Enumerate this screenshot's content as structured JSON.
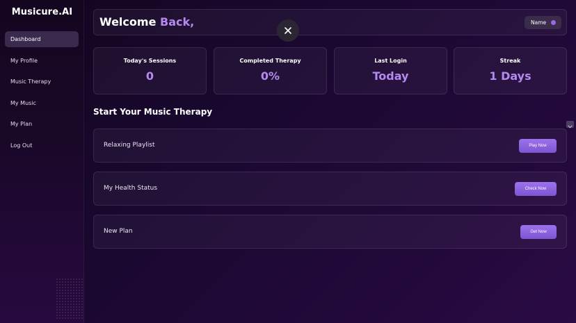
{
  "brand": "Musicure.AI",
  "sidebar": {
    "items": [
      {
        "label": "Dashboard"
      },
      {
        "label": "My Profile"
      },
      {
        "label": "Music Therapy"
      },
      {
        "label": "My Music"
      },
      {
        "label": "My Plan"
      },
      {
        "label": "Log Out"
      }
    ]
  },
  "header": {
    "welcome": "Welcome",
    "welcome_accent": "Back,",
    "name_toggle_label": "Name"
  },
  "stats": [
    {
      "title": "Today's Sessions",
      "value": "0"
    },
    {
      "title": "Completed Therapy",
      "value": "0%"
    },
    {
      "title": "Last Login",
      "value": "Today"
    },
    {
      "title": "Streak",
      "value": "1 Days"
    }
  ],
  "section": {
    "title": "Start Your Music Therapy"
  },
  "rows": [
    {
      "label": "Relaxing Playlist",
      "button": "Play Now"
    },
    {
      "label": "My Health Status",
      "button": "Check Now"
    },
    {
      "label": "New Plan",
      "button": "Get Now"
    }
  ],
  "icons": {
    "close": "close-icon",
    "chevron": "chevron-down-icon"
  },
  "colors": {
    "accent": "#b58af0",
    "button": "#8a60de",
    "active_nav": "#3a2a4d"
  }
}
